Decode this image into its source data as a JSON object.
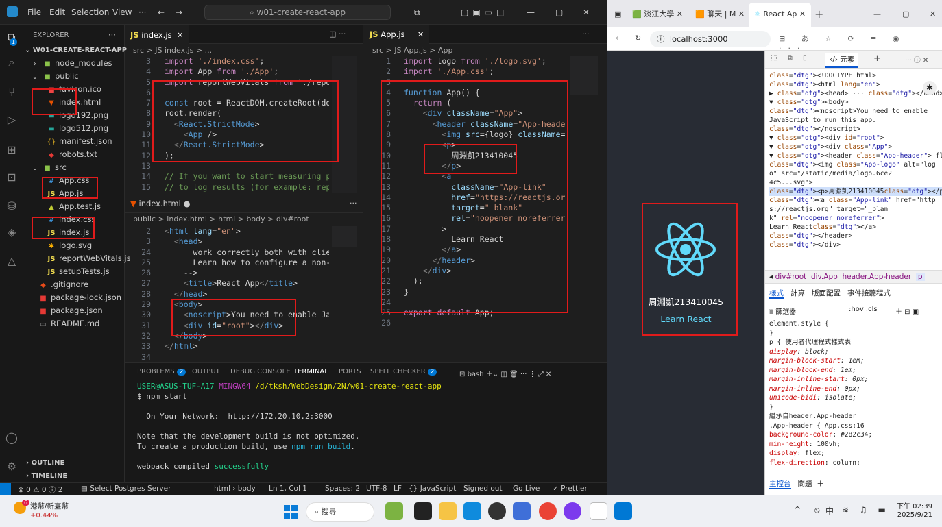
{
  "vscode": {
    "menu": [
      "File",
      "Edit",
      "Selection",
      "View",
      "···"
    ],
    "search": "w01-create-react-app",
    "sidebar": {
      "title": "EXPLORER",
      "project": "W01-CREATE-REACT-APP",
      "items": [
        "node_modules",
        "public",
        "favicon.ico",
        "index.html",
        "logo192.png",
        "logo512.png",
        "manifest.json",
        "robots.txt",
        "src",
        "App.css",
        "App.js",
        "App.test.js",
        "index.css",
        "index.js",
        "logo.svg",
        "reportWebVitals.js",
        "setupTests.js",
        ".gitignore",
        "package-lock.json",
        "package.json",
        "README.md"
      ],
      "outline": "OUTLINE",
      "timeline": "TIMELINE"
    },
    "editor1": {
      "tab": "index.js",
      "breadcrumb": "src > JS index.js > ...",
      "lines": [
        "3",
        "4",
        "5",
        "6",
        "7",
        "8",
        "9",
        "10",
        "11",
        "12",
        "13",
        "14",
        "15"
      ],
      "code": [
        "import './index.css';",
        "import App from './App';",
        "import reportWebVitals from './report",
        "",
        "const root = ReactDOM.createRoot(docu",
        "root.render(",
        "  <React.StrictMode>",
        "    <App />",
        "  </React.StrictMode>",
        ");",
        "",
        "// If you want to start measuring per",
        "// to log results (for example: repor"
      ]
    },
    "editor2": {
      "tab": "index.html",
      "breadcrumb": "public > index.html > html > body > div#root",
      "lines": [
        "2",
        "3",
        "24",
        "25",
        "26",
        "27",
        "28",
        "29",
        "30",
        "31",
        "32",
        "33",
        "34"
      ],
      "code": [
        "<html lang=\"en\">",
        "  <head>",
        "      work correctly both with client",
        "      Learn how to configure a non-ro",
        "    -->",
        "    <title>React App</title>",
        "  </head>",
        "  <body>",
        "    <noscript>You need to enable Java",
        "    <div id=\"root\"></div>",
        "  </body>",
        "</html>",
        ""
      ]
    },
    "editor3": {
      "tab": "App.js",
      "breadcrumb": "src > JS App.js > App",
      "lines": [
        "1",
        "2",
        "3",
        "4",
        "5",
        "6",
        "7",
        "8",
        "9",
        "10",
        "11",
        "12",
        "13",
        "14",
        "15",
        "16",
        "17",
        "18",
        "19",
        "20",
        "21",
        "22",
        "23",
        "24",
        "25",
        "26"
      ],
      "code": [
        "import logo from './logo.svg';",
        "import './App.css';",
        "",
        "function App() {",
        "  return (",
        "    <div className=\"App\">",
        "      <header className=\"App-header\"",
        "        <img src={logo} className=\"A",
        "        <p>",
        "          周淵凱213410045",
        "        </p>",
        "        <a",
        "          className=\"App-link\"",
        "          href=\"https://reactjs.org\"",
        "          target=\"_blank\"",
        "          rel=\"noopener noreferrer\"",
        "        >",
        "          Learn React",
        "        </a>",
        "      </header>",
        "    </div>",
        "  );",
        "}",
        "",
        "export default App;",
        ""
      ]
    },
    "panel": {
      "tabs": [
        "PROBLEMS",
        "OUTPUT",
        "DEBUG CONSOLE",
        "TERMINAL",
        "PORTS",
        "SPELL CHECKER"
      ],
      "problems_count": "2",
      "spell_count": "2",
      "shell": "bash",
      "terminal": [
        "USER@ASUS-TUF-A17 MINGW64 /d/tksh/WebDesign/2N/w01-create-react-app",
        "$ npm start",
        "",
        "  On Your Network:  http://172.20.10.2:3000",
        "",
        "Note that the development build is not optimized.",
        "To create a production build, use npm run build.",
        "",
        "webpack compiled successfully"
      ]
    },
    "status": {
      "errors": "⊗ 0 ⚠ 0 ⓘ 2",
      "postgres": "Select Postgres Server",
      "path": "html › body",
      "position": "Ln 1, Col 1",
      "spaces": "Spaces: 2",
      "encoding": "UTF-8",
      "eol": "LF",
      "lang": "{} JavaScript",
      "signed": "Signed out",
      "golive": "Go Live",
      "prettier": "✓ Prettier"
    }
  },
  "browser": {
    "tabs": [
      "淡江大學",
      "聊天 | M",
      "React Ap"
    ],
    "url": "localhost:3000",
    "page": {
      "name": "周淵凱213410045",
      "link": "Learn React"
    },
    "devtools": {
      "elements_tab": "元素",
      "tree": [
        "<!DOCTYPE html>",
        "<html lang=\"en\">",
        "▶ <head> ··· </head>",
        "▼ <body>",
        "    <noscript>You need to enable",
        "    JavaScript to run this app.",
        "    </noscript>",
        "  ▼ <div id=\"root\">",
        "    ▼ <div class=\"App\">",
        "      ▼ <header class=\"App-header\"> flex",
        "          <img class=\"App-logo\" alt=\"log",
        "          o\" src=\"/static/media/logo.6ce2",
        "          4c5...svg\">",
        "          <p>周淵凱213410045</p> == $0",
        "          <a class=\"App-link\" href=\"http",
        "          s://reactjs.org\" target=\"_blan",
        "          k\" rel=\"noopener noreferrer\">",
        "          Learn React</a>",
        "        </header>",
        "      </div>"
      ],
      "crumbs": [
        "div#root",
        "div.App",
        "header.App-header",
        "p"
      ],
      "style_tabs": [
        "樣式",
        "計算",
        "版面配置",
        "事件接聽程式"
      ],
      "filter": "篩選器",
      "hov": ":hov .cls",
      "styles": [
        "element.style {",
        "}",
        "p {                    使用者代理程式樣式表",
        "  display: block;",
        "  margin-block-start: 1em;",
        "  margin-block-end: 1em;",
        "  margin-inline-start: 0px;",
        "  margin-inline-end: 0px;",
        "  unicode-bidi: isolate;",
        "}",
        "繼承自header.App-header",
        ".App-header {              App.css:16",
        "  background-color: #282c34;",
        "  min-height: 100vh;",
        "  display: flex;",
        "  flex-direction: column;"
      ],
      "bottom_tabs": [
        "主控台",
        "問題"
      ]
    }
  },
  "taskbar": {
    "stock": "港幣/新臺幣",
    "stock_change": "+0.44%",
    "badge": "6",
    "search": "搜尋",
    "lang": "中",
    "time": "下午 02:39",
    "date": "2025/9/21"
  }
}
